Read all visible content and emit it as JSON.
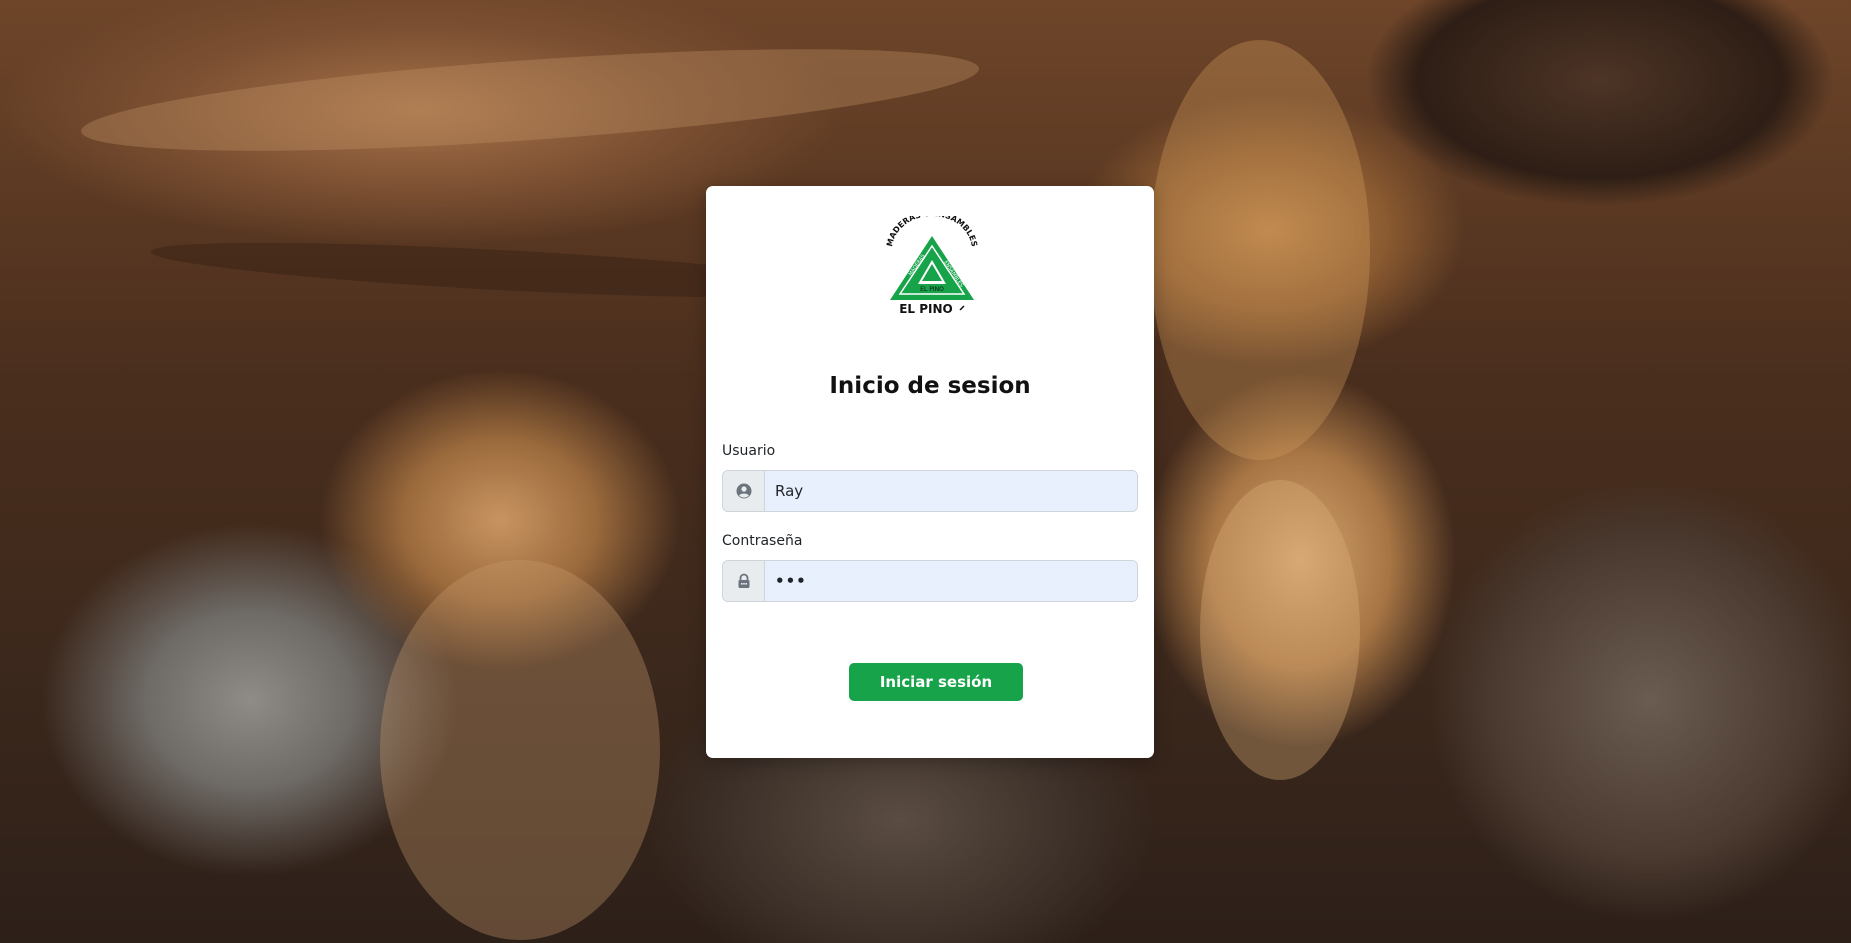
{
  "page": {
    "background": "stacked wood logs photo"
  },
  "logo": {
    "arc_text": "MADERAS Y ENSAMBLES",
    "name": "EL PINO",
    "inner_left": "MADERAS",
    "inner_right": "ENSAMBLES",
    "inner_bottom": "EL PINO",
    "color": "#16a34a"
  },
  "login": {
    "title": "Inicio de sesion",
    "username_label": "Usuario",
    "username_value": "Ray",
    "password_label": "Contraseña",
    "password_value": "•••",
    "submit_label": "Iniciar sesión"
  },
  "icons": {
    "user": "user-circle-icon",
    "password": "lock-icon"
  },
  "colors": {
    "accent": "#16a34a",
    "input_bg": "#e8f0fe",
    "card_bg": "#ffffff"
  }
}
